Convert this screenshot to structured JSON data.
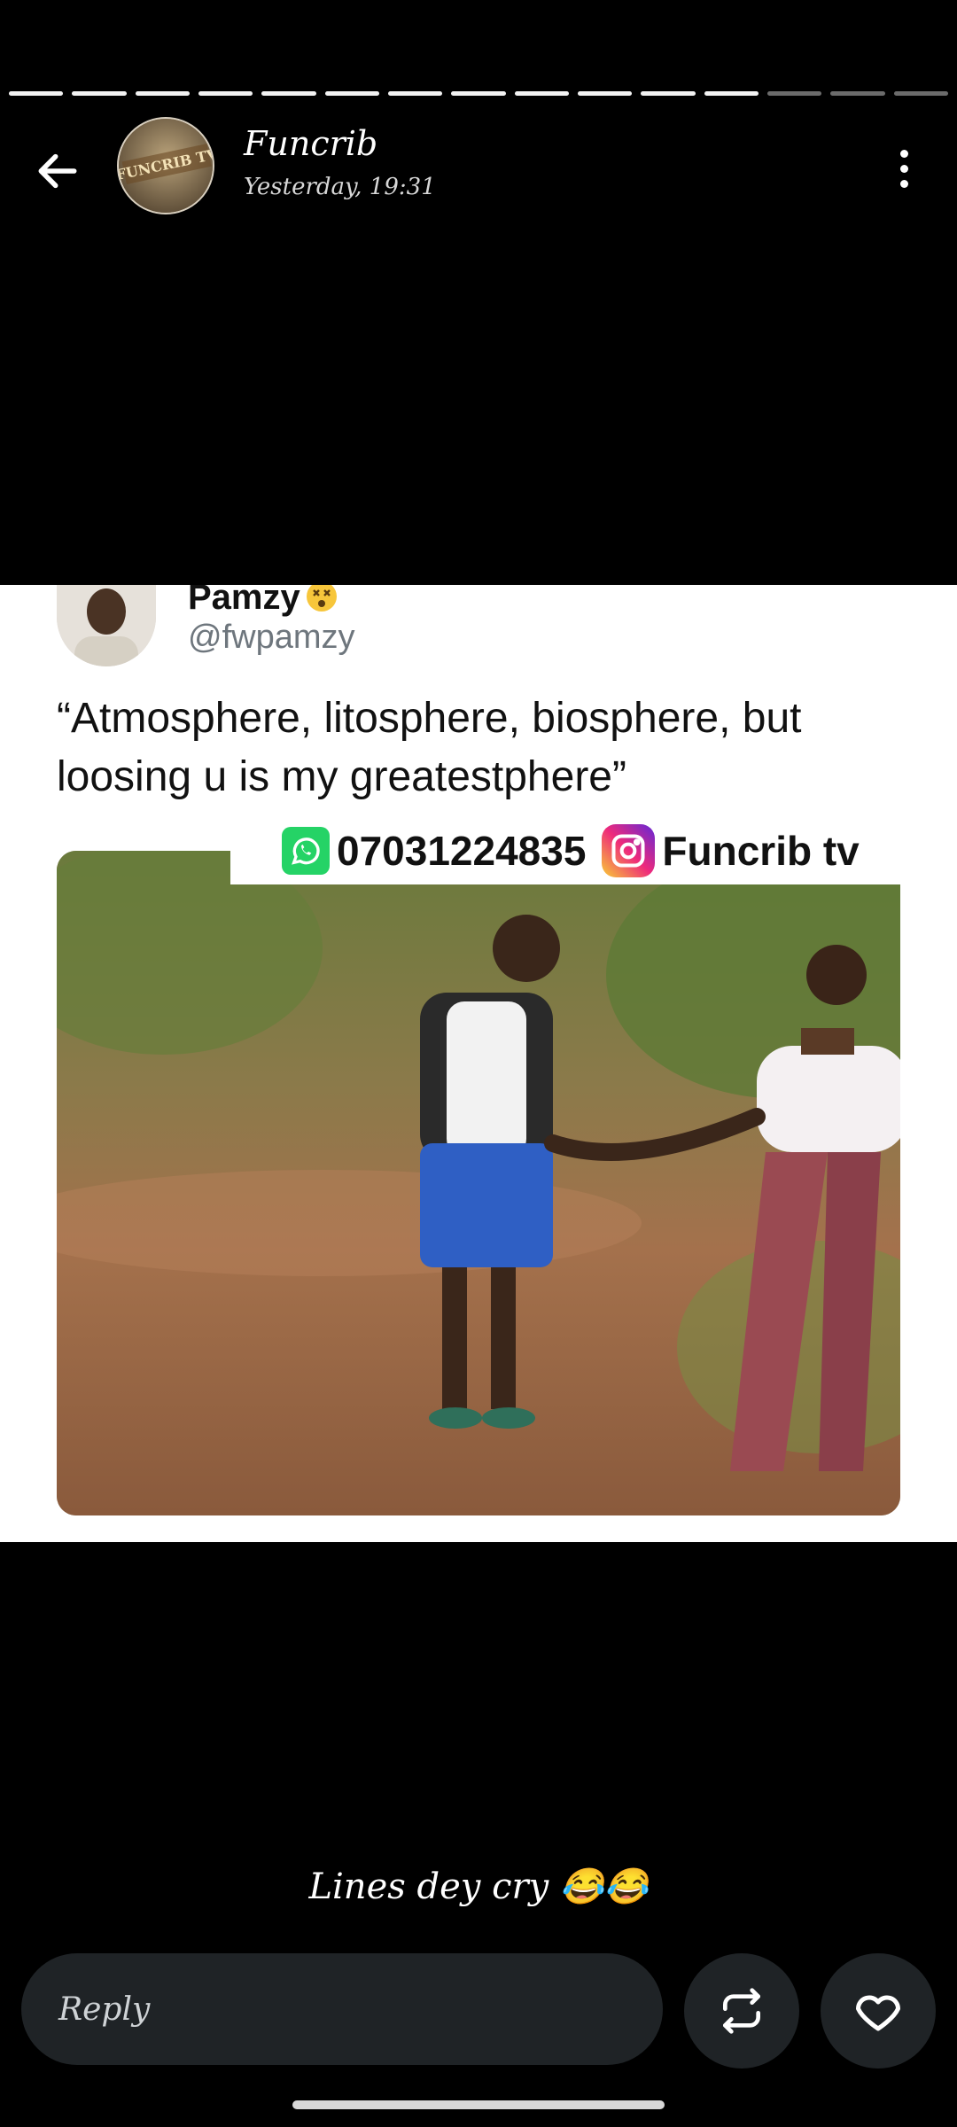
{
  "progress": {
    "total_segments": 15,
    "completed_segments": 12
  },
  "header": {
    "title": "Funcrib",
    "timestamp": "Yesterday, 19:31",
    "avatar_text": "FUNCRIB TV"
  },
  "post": {
    "author_name": "Pamzy",
    "author_handle": "@fwpamzy",
    "text": "“Atmosphere, litosphere, biosphere, but loosing u is my  greatestphere”",
    "watermark_phone": "07031224835",
    "watermark_brand": "Funcrib tv"
  },
  "caption": "Lines dey cry 😂😂",
  "footer": {
    "reply_placeholder": "Reply"
  },
  "icons": {
    "back": "arrow-left",
    "menu": "more-vertical",
    "repost": "repost",
    "like": "heart"
  }
}
